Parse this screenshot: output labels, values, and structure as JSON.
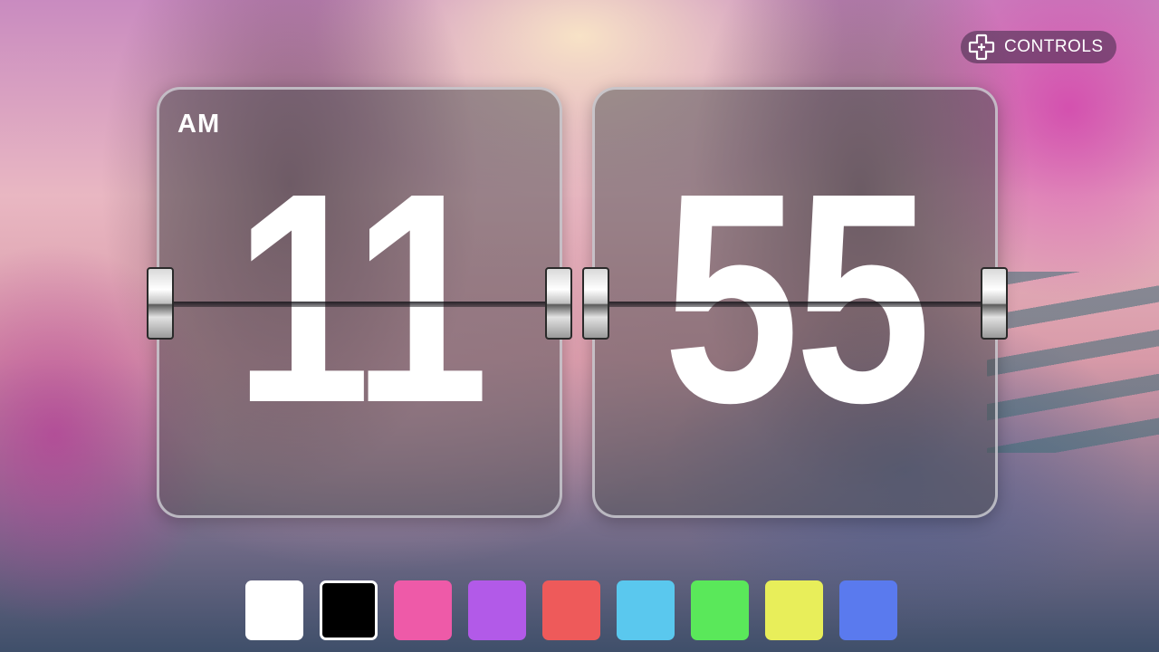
{
  "controls": {
    "label": "CONTROLS",
    "icon": "dpad-icon"
  },
  "clock": {
    "period": "AM",
    "hours": "11",
    "minutes": "55"
  },
  "swatches": [
    {
      "name": "white",
      "color": "#ffffff",
      "selected": false
    },
    {
      "name": "black",
      "color": "#000000",
      "selected": true
    },
    {
      "name": "pink",
      "color": "#ee5aa8",
      "selected": false
    },
    {
      "name": "purple",
      "color": "#b25ae8",
      "selected": false
    },
    {
      "name": "red",
      "color": "#ee5a5a",
      "selected": false
    },
    {
      "name": "sky-blue",
      "color": "#5ac8ee",
      "selected": false
    },
    {
      "name": "green",
      "color": "#5ae85a",
      "selected": false
    },
    {
      "name": "yellow",
      "color": "#e8ee5a",
      "selected": false
    },
    {
      "name": "blue",
      "color": "#5a7aee",
      "selected": false
    }
  ]
}
